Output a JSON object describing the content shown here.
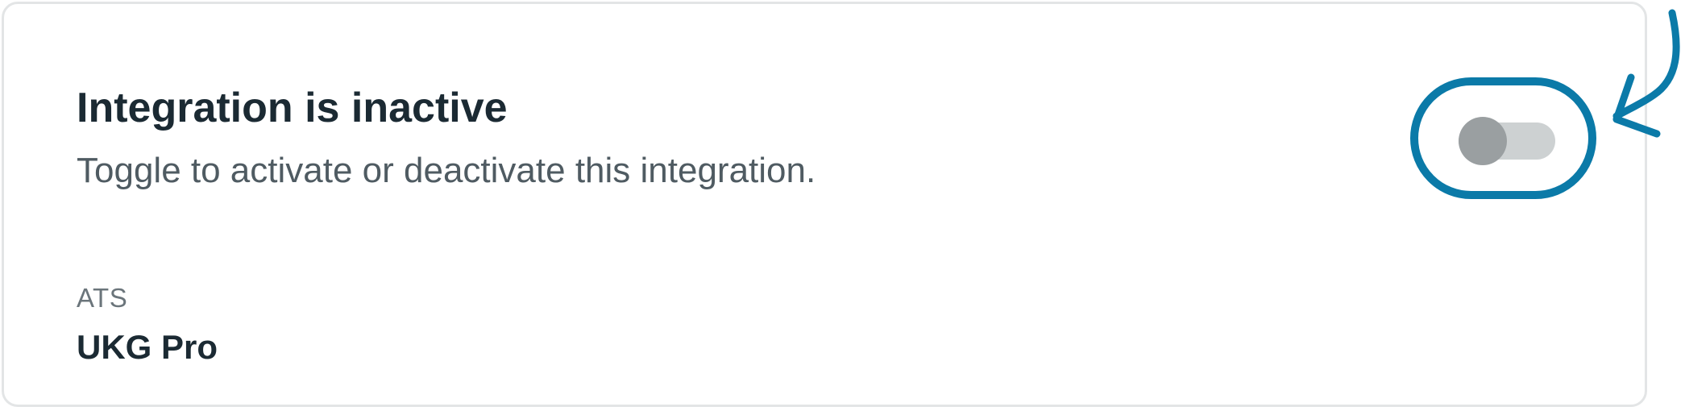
{
  "integration": {
    "title": "Integration is inactive",
    "description": "Toggle to activate or deactivate this integration.",
    "ats_label": "ATS",
    "ats_value": "UKG Pro",
    "toggle_active": false
  },
  "colors": {
    "highlight": "#0b7aa8",
    "track": "#cdd1d2",
    "knob": "#9a9fa1",
    "title_text": "#1b2a33",
    "muted_text": "#4f5b62",
    "card_border": "#e3e5e6"
  },
  "icons": {
    "annotation": "curved-arrow-icon"
  }
}
